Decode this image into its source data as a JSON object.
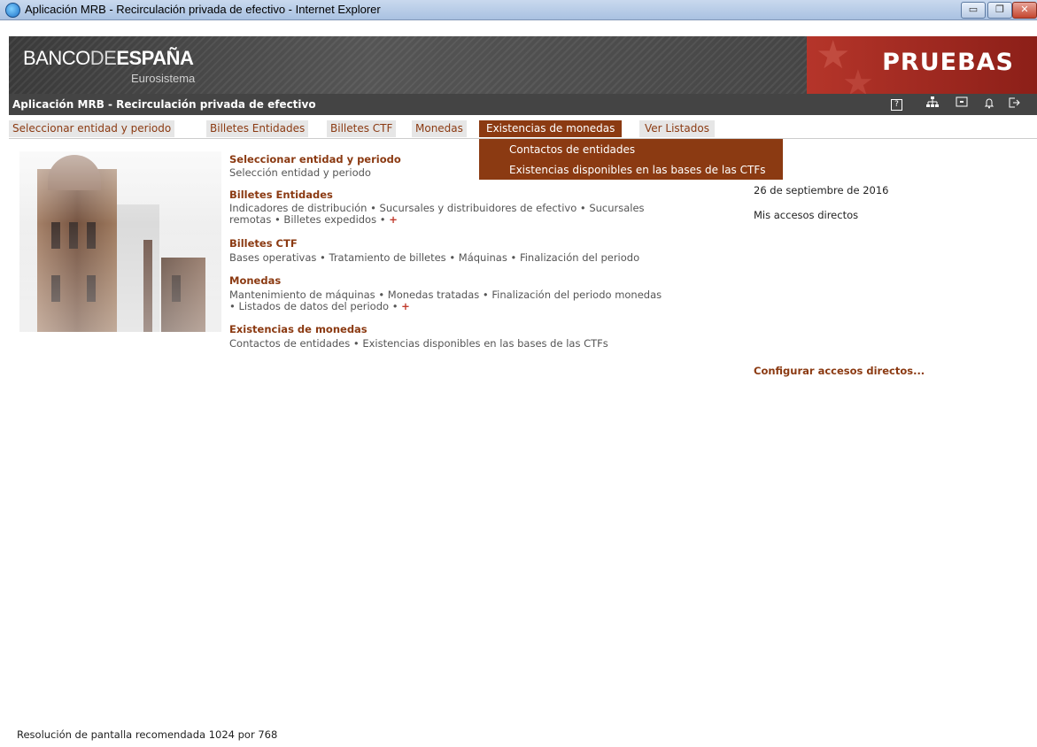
{
  "window": {
    "title": "Aplicación MRB - Recirculación privada de efectivo - Internet Explorer",
    "buttons": {
      "minimize": "▭",
      "maximize": "❐",
      "close": "✕"
    }
  },
  "banner": {
    "logo_banco": "BANCO",
    "logo_de": "DE",
    "logo_espana": "ESPAÑA",
    "logo_sub": "Eurosistema",
    "pruebas": "PRUEBAS"
  },
  "appbar": {
    "title": "Aplicación MRB - Recirculación privada de efectivo",
    "tools": [
      {
        "name": "help-icon",
        "glyph": "?"
      },
      {
        "name": "sitemap-icon",
        "glyph": "⛶"
      },
      {
        "name": "window-icon",
        "glyph": "▣"
      },
      {
        "name": "bell-icon",
        "glyph": "🔔"
      },
      {
        "name": "logout-icon",
        "glyph": "⇥"
      }
    ]
  },
  "menu": {
    "items": [
      "Seleccionar entidad y periodo",
      "Billetes Entidades",
      "Billetes CTF",
      "Monedas",
      "Existencias de monedas",
      "Ver Listados"
    ],
    "active_index": 4,
    "dropdown": [
      "Contactos de entidades",
      "Existencias disponibles en las bases de las CTFs"
    ]
  },
  "sections": [
    {
      "title": "Seleccionar entidad y periodo",
      "lines": [
        "Selección entidad y periodo"
      ]
    },
    {
      "title": "Billetes Entidades",
      "lines": [
        "Indicadores de distribución • Sucursales y distribuidores de efectivo • Sucursales",
        "remotas • Billetes expedidos •"
      ]
    },
    {
      "title": "Billetes CTF",
      "lines": [
        "Bases operativas • Tratamiento de billetes • Máquinas • Finalización del periodo"
      ]
    },
    {
      "title": "Monedas",
      "lines": [
        "Mantenimiento de máquinas • Monedas tratadas • Finalización del periodo monedas",
        "• Listados de datos del periodo •"
      ]
    },
    {
      "title": "Existencias de monedas",
      "lines": [
        "Contactos de entidades • Existencias disponibles en las bases de las CTFs"
      ]
    }
  ],
  "plus": "+",
  "sidebar": {
    "date": "26 de septiembre de 2016",
    "shortcuts": "Mis accesos directos",
    "configure": "Configurar accesos directos..."
  },
  "footer": "Resolución de pantalla recomendada 1024 por 768",
  "colors": {
    "accent": "#8b3a12",
    "banner_red": "#b5352a",
    "appbar": "#444444"
  }
}
